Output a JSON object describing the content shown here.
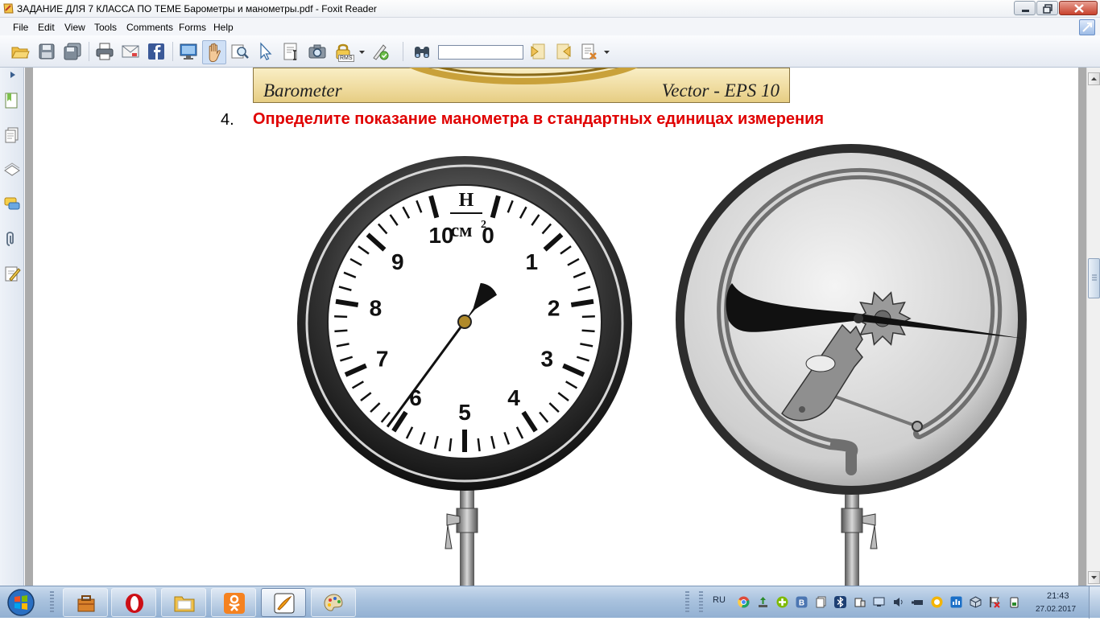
{
  "window": {
    "title": "ЗАДАНИЕ ДЛЯ 7 КЛАССА ПО ТЕМЕ Барометры и манометры.pdf - Foxit Reader"
  },
  "menu": {
    "items": [
      "File",
      "Edit",
      "View",
      "Tools",
      "Comments",
      "Forms",
      "Help"
    ]
  },
  "toolbar": {
    "search_value": "",
    "icons": [
      "open-icon",
      "save-icon",
      "save-all-icon",
      "print-icon",
      "email-icon",
      "facebook-icon",
      "fullscreen-icon",
      "hand-tool-icon",
      "zoom-tool-icon",
      "select-tool-icon",
      "text-select-icon",
      "snapshot-icon",
      "rms-lock-icon",
      "sign-icon",
      "find-binoculars-icon",
      "find-prev-icon",
      "find-next-icon",
      "find-options-icon"
    ],
    "rms_label": "RMS"
  },
  "document": {
    "banner_left": "Barometer",
    "banner_right": "Vector - EPS 10",
    "question_number": "4.",
    "question_text": "Определите показание манометра в стандартных единицах измерения",
    "gauge": {
      "unit_numerator": "Н",
      "unit_denominator": "см",
      "unit_exponent": "2",
      "dial_labels": [
        "0",
        "1",
        "2",
        "3",
        "4",
        "5",
        "6",
        "7",
        "8",
        "9",
        "10"
      ],
      "needle_value": 6.1,
      "needle_value_range": [
        0,
        10
      ]
    }
  },
  "taskbar": {
    "language": "RU",
    "time": "21:43",
    "date": "27.02.2017"
  },
  "colors": {
    "question_red": "#e00000",
    "banner_gold": "#efdb9e"
  }
}
